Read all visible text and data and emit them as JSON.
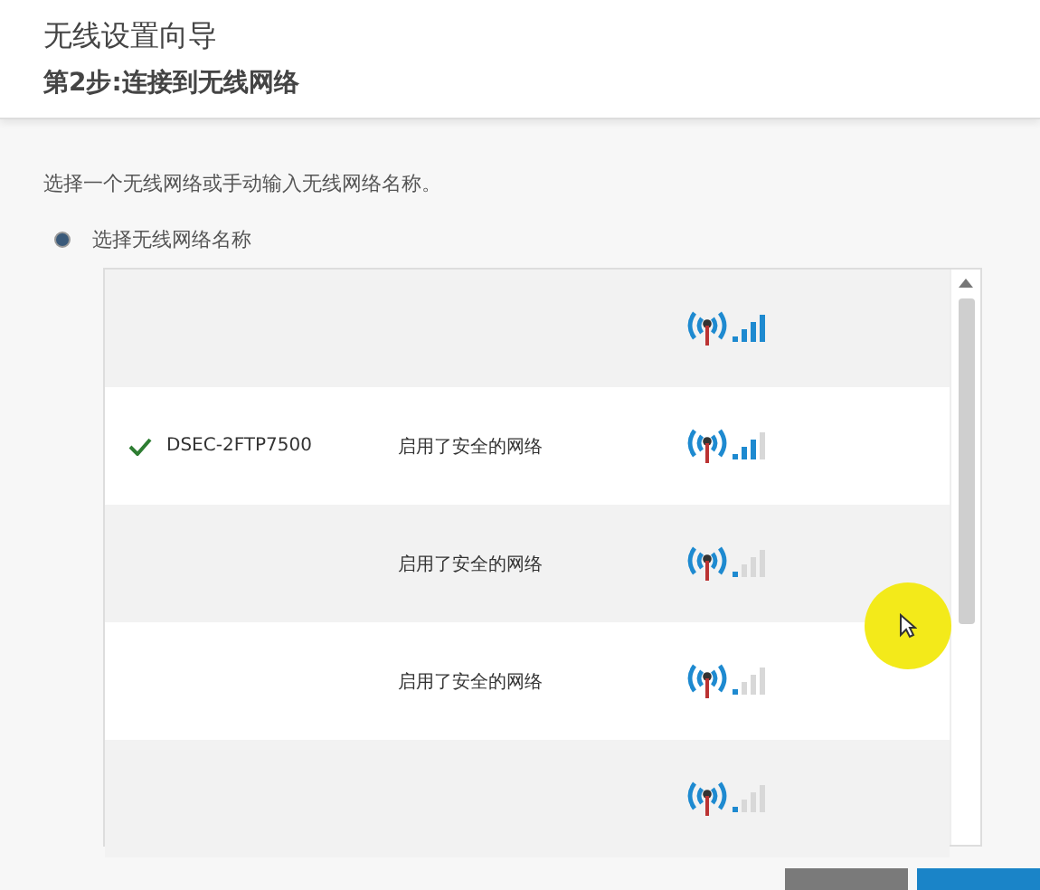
{
  "header": {
    "title": "无线设置向导",
    "subtitle": "第2步:连接到无线网络"
  },
  "instruction": "选择一个无线网络或手动输入无线网络名称。",
  "option": {
    "label": "选择无线网络名称",
    "selected": true
  },
  "networks": [
    {
      "kind": "full",
      "selected": false
    },
    {
      "name": "DSEC-2FTP7500",
      "security": "启用了安全的网络",
      "kind": "good",
      "selected": true
    },
    {
      "security": "启用了安全的网络",
      "kind": "weak",
      "selected": false
    },
    {
      "security": "启用了安全的网络",
      "kind": "weak",
      "selected": false
    },
    {
      "kind": "weak",
      "selected": false
    }
  ],
  "buttons": [
    {
      "kind": "secondary"
    },
    {
      "kind": "primary"
    }
  ]
}
